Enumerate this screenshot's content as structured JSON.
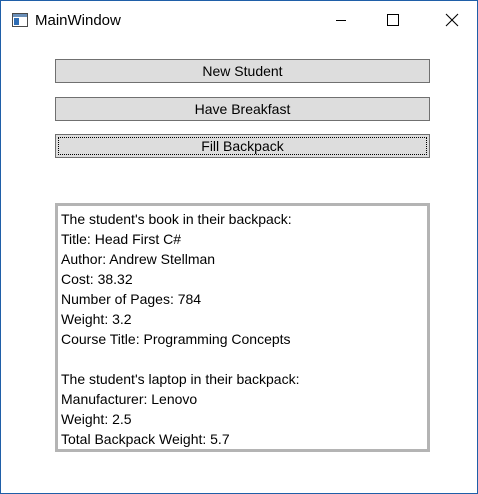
{
  "window": {
    "title": "MainWindow",
    "app_icon": "window-app-icon",
    "controls": {
      "minimize_icon": "minimize-icon",
      "maximize_icon": "maximize-icon",
      "close_icon": "close-icon"
    }
  },
  "buttons": {
    "new_student": "New Student",
    "have_breakfast": "Have Breakfast",
    "fill_backpack": "Fill Backpack"
  },
  "output": {
    "lines": [
      "The student's book in their backpack:",
      "Title: Head First C#",
      "Author: Andrew Stellman",
      "Cost: 38.32",
      "Number of Pages: 784",
      "Weight: 3.2",
      "Course Title: Programming Concepts",
      "",
      "The student's laptop in their backpack:",
      "Manufacturer: Lenovo",
      "Weight: 2.5",
      "Total Backpack Weight: 5.7"
    ]
  },
  "colors": {
    "window_border": "#1f5fa8",
    "button_face": "#dddddd",
    "button_border": "#707070",
    "textbox_border": "#b4b4b4"
  }
}
